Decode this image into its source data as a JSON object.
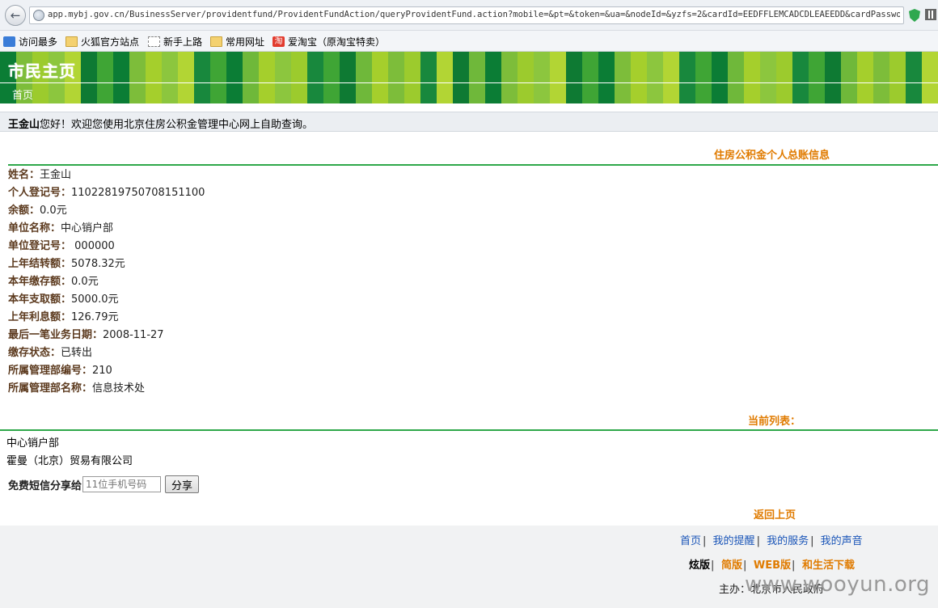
{
  "browser": {
    "url": "app.mybj.gov.cn/BusinessServer/providentfund/ProvidentFundAction/queryProvidentFund.action?mobile=&pt=&token=&ua=&nodeId=&yzfs=2&cardId=EEDFFLEMCADCDLEAEEDD&cardPassword=EAEEDD("
  },
  "bookmarks": [
    {
      "label": "访问最多",
      "icon": "most-visited-icon"
    },
    {
      "label": "火狐官方站点",
      "icon": "folder-icon"
    },
    {
      "label": "新手上路",
      "icon": "page-icon"
    },
    {
      "label": "常用网址",
      "icon": "folder-icon"
    },
    {
      "label": "爱淘宝（原淘宝特卖）",
      "icon": "taobao-icon"
    }
  ],
  "header": {
    "logo": "市民主页",
    "nav_home": "首页",
    "stripe_colors": [
      "#0b7d35",
      "#8cc63e",
      "#3fa535",
      "#a5cf2c",
      "#18883d",
      "#6fb83a",
      "#9ccb2d",
      "#0e7a33",
      "#7dbd3a",
      "#b2d534"
    ]
  },
  "welcome": {
    "name": "王金山",
    "message": "您好！欢迎您使用北京住房公积金管理中心网上自助查询。"
  },
  "account": {
    "title": "住房公积金个人总账信息",
    "fields": [
      {
        "label": "姓名：",
        "value": "王金山"
      },
      {
        "label": "个人登记号：",
        "value": "110228197507081511​00"
      },
      {
        "label": "余额：",
        "value": "0.0元"
      },
      {
        "label": "单位名称：",
        "value": "中心销户部"
      },
      {
        "label": "单位登记号：",
        "value": " 000000"
      },
      {
        "label": "上年结转额：",
        "value": "5078.32元"
      },
      {
        "label": "本年缴存额：",
        "value": "0.0元"
      },
      {
        "label": "本年支取额：",
        "value": "5000.0元"
      },
      {
        "label": "上年利息额：",
        "value": "126.79元"
      },
      {
        "label": "最后一笔业务日期：",
        "value": "2008-11-27"
      },
      {
        "label": "缴存状态：",
        "value": "已转出"
      },
      {
        "label": "所属管理部编号：",
        "value": "210"
      },
      {
        "label": "所属管理部名称：",
        "value": "信息技术处"
      }
    ]
  },
  "current_list": {
    "title": "当前列表：",
    "items": [
      "中心销户部",
      "霍曼（北京）贸易有限公司"
    ]
  },
  "sms": {
    "label": "免费短信分享给",
    "placeholder": "11位手机号码",
    "button": "分享"
  },
  "back_label": "返回上页",
  "footer": {
    "links": [
      "首页",
      "我的提醒",
      "我的服务",
      "我的声音"
    ],
    "versions": {
      "current": "炫版",
      "others": [
        "简版",
        "WEB版",
        "和生活下载"
      ]
    },
    "host": "主办：北京市人民政府",
    "watermark": "www.wooyun.org"
  }
}
